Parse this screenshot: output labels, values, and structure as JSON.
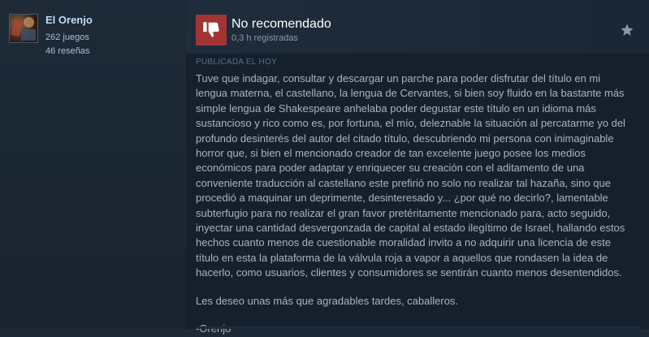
{
  "author": {
    "username": "El Orenjo",
    "games": "262 juegos",
    "reviews": "46 reseñas"
  },
  "review": {
    "verdict": "No recomendado",
    "hours": "0,3 h registradas",
    "verdict_icon": "thumbs-down-icon",
    "verdict_color": "#a33434",
    "posted": "PUBLICADA EL HOY",
    "paragraphs": [
      "Tuve que indagar, consultar y descargar un parche para poder disfrutar del título en mi lengua materna, el castellano, la lengua de Cervantes, si bien soy fluido en la bastante más simple lengua de Shakespeare anhelaba poder degustar este título en un idioma más sustancioso y rico como es, por fortuna, el mío, deleznable la situación al percatarme yo del profundo desinterés del autor del citado título, descubriendo mi persona con inimaginable horror que, si bien el mencionado creador de tan excelente juego posee los medios económicos para poder adaptar y enriquecer su creación con el aditamento de una conveniente traducción al castellano este prefirió no solo no realizar tal hazaña, sino que procedió a maquinar un deprimente, desinteresado y... ¿por qué no decirlo?, lamentable subterfugio para no realizar el gran favor pretéritamente mencionado para, acto seguido, inyectar una cantidad desvergonzada de capital al estado ilegítimo de Israel, hallando estos hechos cuanto menos de cuestionable moralidad invito a no adquirir una licencia de este título en esta la plataforma de la válvula roja a vapor a aquellos que rondasen la idea de hacerlo, como usuarios, clientes y consumidores se sentirán cuanto menos desentendidos.",
      "Les deseo unas más que agradables tardes, caballeros.",
      "-Orenjo"
    ]
  }
}
